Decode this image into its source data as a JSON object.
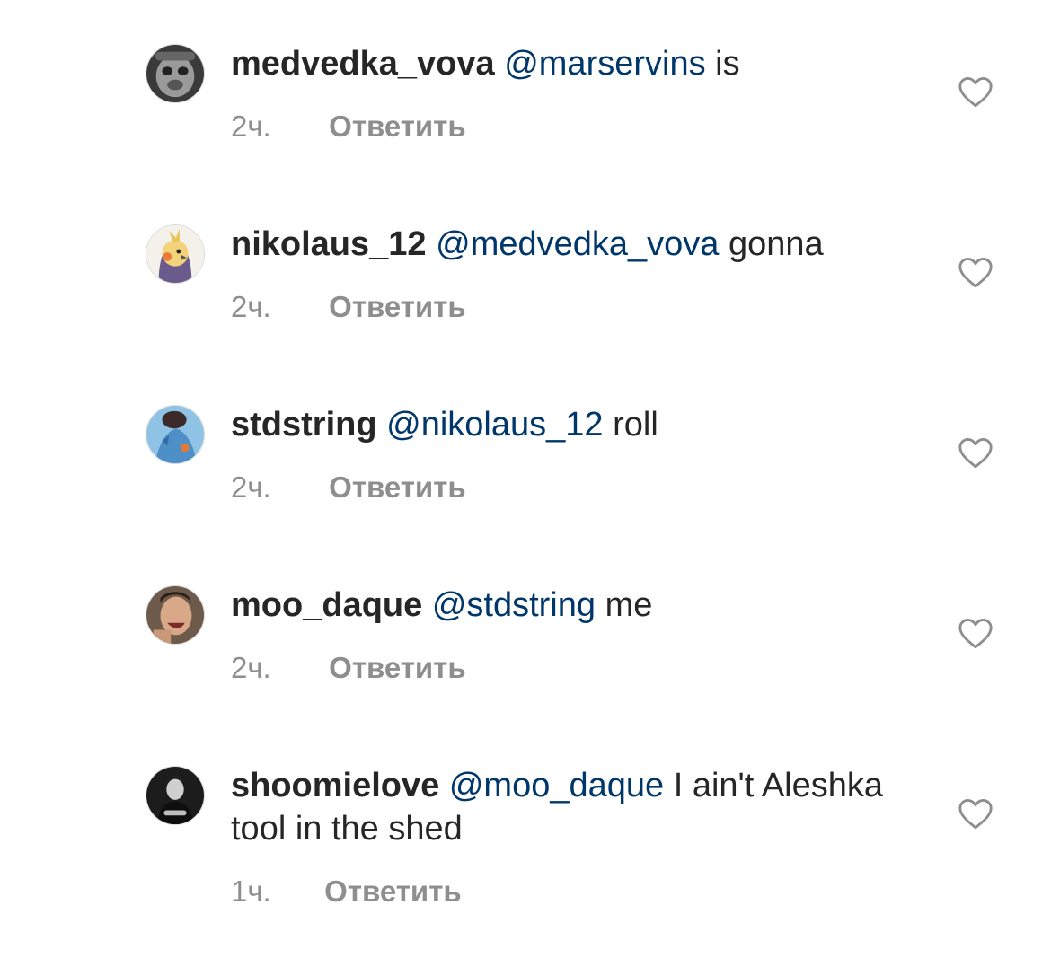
{
  "comments": [
    {
      "username": "medvedka_vova",
      "mention": "@marservins",
      "text": " is",
      "time": "2ч.",
      "reply_label": "Ответить",
      "avatar_icon": "avatar-grayscale-face",
      "like_icon": "heart-outline-icon"
    },
    {
      "username": "nikolaus_12",
      "mention": "@medvedka_vova",
      "text": " gonna",
      "time": "2ч.",
      "reply_label": "Ответить",
      "avatar_icon": "avatar-cockatiel-bird",
      "like_icon": "heart-outline-icon"
    },
    {
      "username": "stdstring",
      "mention": "@nikolaus_12",
      "text": " roll",
      "time": "2ч.",
      "reply_label": "Ответить",
      "avatar_icon": "avatar-blue-illustration",
      "like_icon": "heart-outline-icon"
    },
    {
      "username": "moo_daque",
      "mention": "@stdstring",
      "text": " me",
      "time": "2ч.",
      "reply_label": "Ответить",
      "avatar_icon": "avatar-laughing-person",
      "like_icon": "heart-outline-icon"
    },
    {
      "username": "shoomielove",
      "mention": "@moo_daque",
      "text": " I ain't Aleshka tool in the shed",
      "time": "1ч.",
      "reply_label": "Ответить",
      "avatar_icon": "avatar-dark-portrait",
      "like_icon": "heart-outline-icon"
    }
  ],
  "colors": {
    "text": "#262626",
    "mention": "#00376b",
    "meta": "#8e8e8e",
    "background": "#ffffff"
  }
}
